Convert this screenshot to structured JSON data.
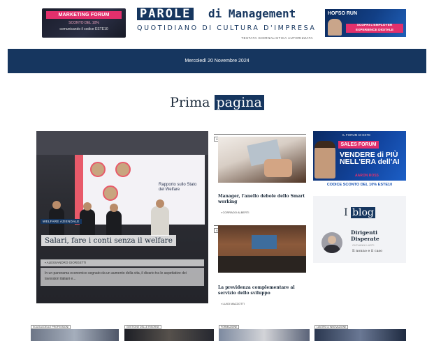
{
  "header": {
    "ad_left": {
      "title": "MARKETING FORUM",
      "line2": "SCONTO DEL 10%",
      "line3": "comunicando il codice ESTE10"
    },
    "logo": {
      "box": "PAROLE",
      "rest": "di Management",
      "subtitle": "QUOTIDIANO DI CULTURA D'IMPRESA",
      "testata": "TESTATA GIORNALISTICA AUTORIZZATA"
    },
    "ad_right": {
      "brand": "HOFSO RUN",
      "cta_line1": "SCOPRI L'EMPLOYER",
      "cta_line2": "EXPERIENCE DIGITALE"
    }
  },
  "datebar": {
    "date": "Mercoledì 20 Novembre 2024"
  },
  "section": {
    "title_plain": "Prima",
    "title_highlight": "pagina"
  },
  "feature": {
    "tag": "WELFARE AZIENDALE",
    "headline": "Salari, fare i conti senza il welfare",
    "author": "ALESSANDRO GIORGETTI",
    "excerpt": "In un panorama economico segnato da un aumento della vita, il divario tra le aspettative dei lavoratori italiani e...",
    "screen_text": "Rapporto sullo Stato del Welfare"
  },
  "mid": {
    "items": [
      {
        "label": "VALORE SOCIALE",
        "title": "Manager, l'anello debole dello Smart working",
        "author": "CORRADO ALBERTI"
      },
      {
        "label": "VALORE SOCIALE",
        "title": "La previdenza complementare al servizio dello sviluppo",
        "author": "LUIGI MAZZOTTI"
      }
    ]
  },
  "right": {
    "ad": {
      "top": "IL FORUM DI ESTE",
      "forum": "SALES FORUM",
      "line1": "VENDERE di PIÙ",
      "line2": "NELL'ERA dell'AI",
      "speaker": "AARON ROSS"
    },
    "codice": "CODICE SCONTO DEL 10% ESTE10",
    "blog": {
      "title_plain": "I",
      "title_highlight": "blog",
      "name_line1": "Dirigenti",
      "name_line2": "Disperate",
      "small": "GIOVANNI LASTI",
      "desc": "Il nonno e il caso"
    }
  },
  "bottom": {
    "labels": [
      "SCUOLA DELLE PROFESSIONI",
      "GESTIONE DELLE RISORSE",
      "FORMAZIONE",
      "LAVORO & INNOVAZIONE"
    ]
  }
}
